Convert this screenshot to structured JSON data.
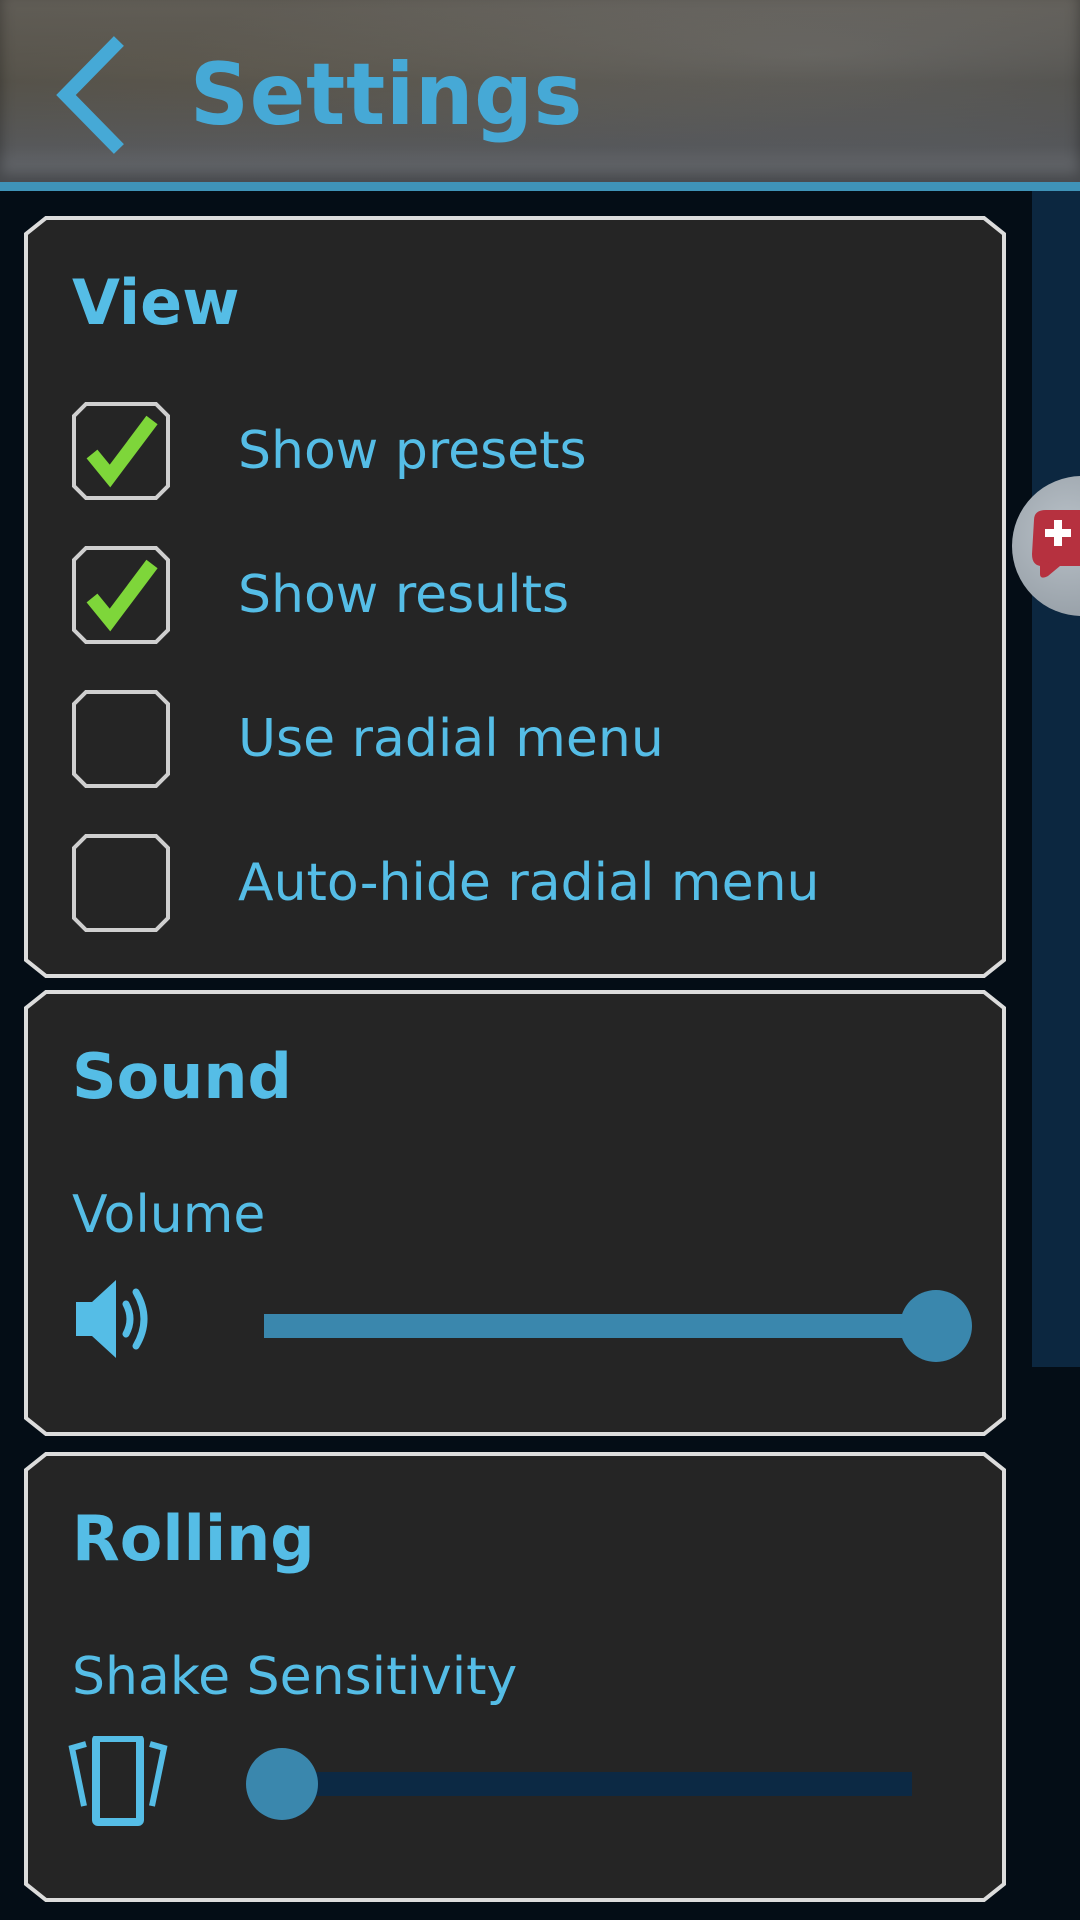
{
  "header": {
    "title": "Settings",
    "back_icon": "chevron-left-icon"
  },
  "colors": {
    "accent": "#55bde6",
    "header_title": "#46a9d6",
    "check": "#7ed63a",
    "card_bg": "#252525",
    "card_border": "#dcdcdc",
    "slider": "#3a87ad",
    "slider_track": "#0c2944",
    "page_bg": "#040d16"
  },
  "view": {
    "title": "View",
    "options": [
      {
        "label": "Show presets",
        "checked": true
      },
      {
        "label": "Show results",
        "checked": true
      },
      {
        "label": "Use radial menu",
        "checked": false
      },
      {
        "label": "Auto-hide radial menu",
        "checked": false
      }
    ]
  },
  "sound": {
    "title": "Sound",
    "volume_label": "Volume",
    "volume_icon": "speaker-icon",
    "volume_value": 1.0
  },
  "rolling": {
    "title": "Rolling",
    "shake_label": "Shake Sensitivity",
    "shake_icon": "vibrate-phone-icon",
    "shake_value": 0.0
  },
  "floating_button": {
    "icon": "gamepad-add-icon"
  }
}
